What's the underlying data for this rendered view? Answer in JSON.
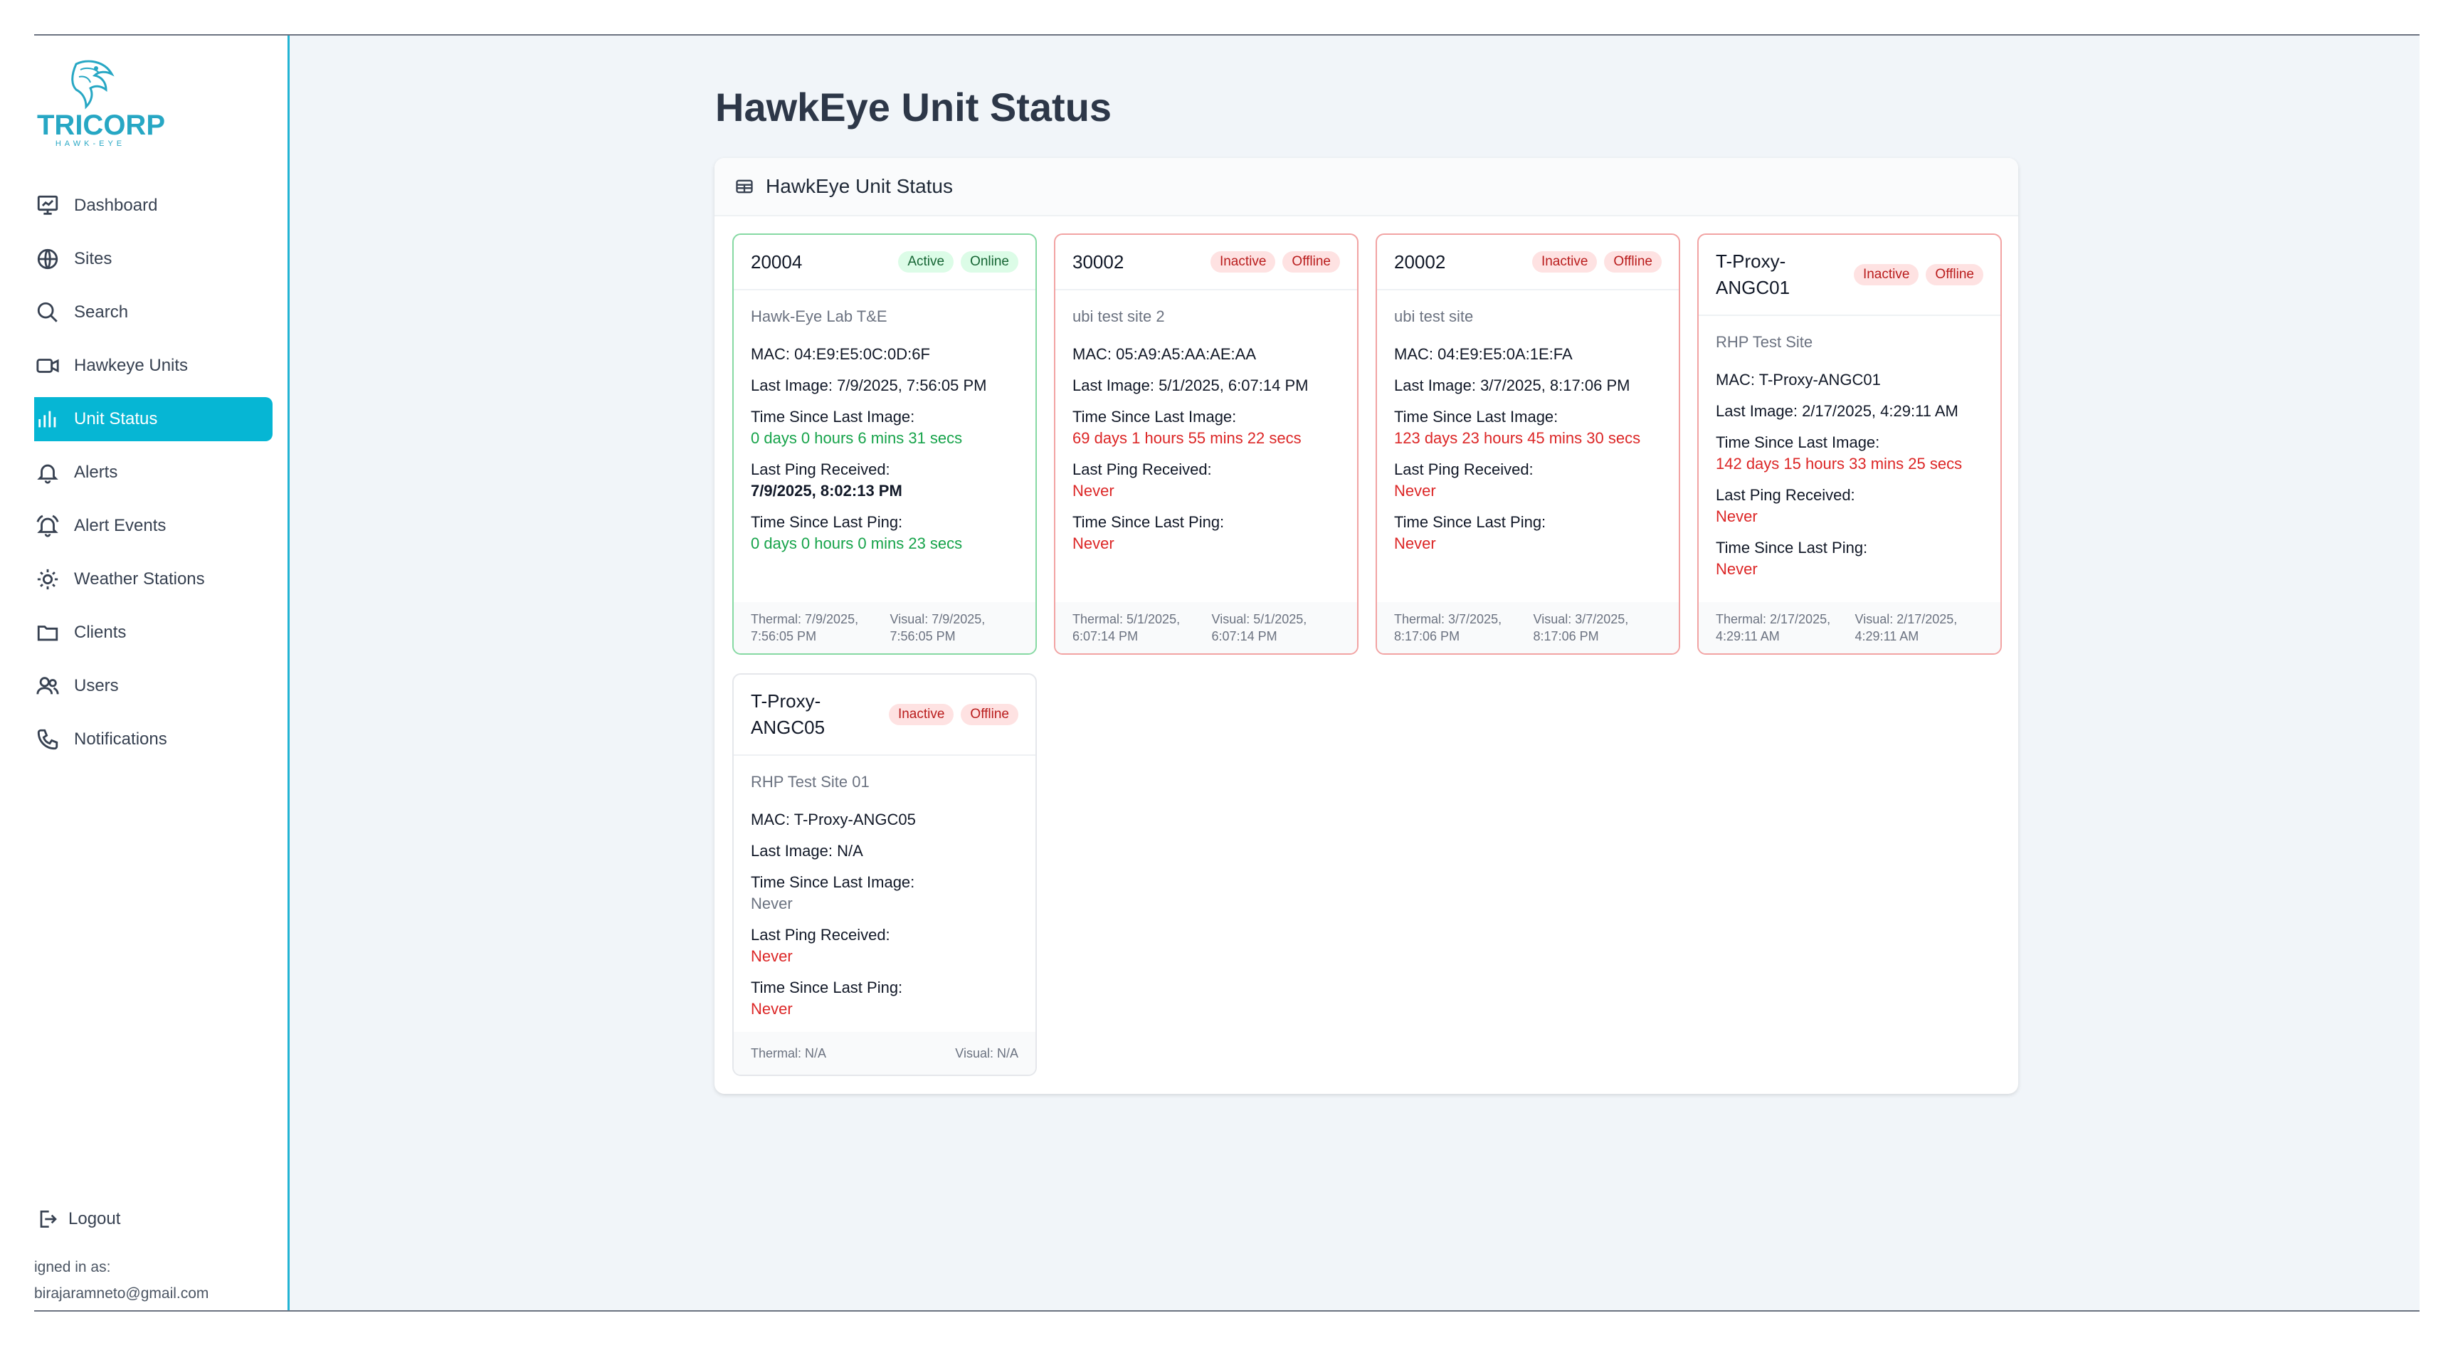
{
  "brand": {
    "name": "TRICORP",
    "tagline": "HAWK-EYE"
  },
  "nav": [
    {
      "label": "Dashboard",
      "icon": "chart-board-icon"
    },
    {
      "label": "Sites",
      "icon": "globe-icon"
    },
    {
      "label": "Search",
      "icon": "search-icon"
    },
    {
      "label": "Hawkeye Units",
      "icon": "video-icon"
    },
    {
      "label": "Unit Status",
      "icon": "bar-chart-icon",
      "active": true
    },
    {
      "label": "Alerts",
      "icon": "bell-icon"
    },
    {
      "label": "Alert Events",
      "icon": "bell-ring-icon"
    },
    {
      "label": "Weather Stations",
      "icon": "sun-icon"
    },
    {
      "label": "Clients",
      "icon": "folder-icon"
    },
    {
      "label": "Users",
      "icon": "users-icon"
    },
    {
      "label": "Notifications",
      "icon": "phone-icon"
    }
  ],
  "logout": {
    "label": "Logout"
  },
  "signed_in": {
    "label": "igned in as:",
    "email": "birajaramneto@gmail.com"
  },
  "page": {
    "title": "HawkEye Unit Status",
    "panel_title": "HawkEye Unit Status"
  },
  "labels": {
    "time_since_last_image": "Time Since Last Image:",
    "last_ping_received": "Last Ping Received:",
    "time_since_last_ping": "Time Since Last Ping:"
  },
  "colors": {
    "accent": "#06b6d4",
    "ok": "#16a34a",
    "bad": "#dc2626"
  },
  "units": [
    {
      "name": "20004",
      "status": "Active",
      "connection": "Online",
      "site": "Hawk-Eye Lab T&E",
      "mac": "MAC: 04:E9:E5:0C:0D:6F",
      "last_image": "Last Image: 7/9/2025, 7:56:05 PM",
      "time_since_image": "0 days 0 hours 6 mins 31 secs",
      "last_ping": "7/9/2025, 8:02:13 PM",
      "time_since_ping": "0 days 0 hours 0 mins 23 secs",
      "thermal": "Thermal: 7/9/2025, 7:56:05 PM",
      "visual": "Visual: 7/9/2025, 7:56:05 PM"
    },
    {
      "name": "30002",
      "status": "Inactive",
      "connection": "Offline",
      "site": "ubi test site 2",
      "mac": "MAC: 05:A9:A5:AA:AE:AA",
      "last_image": "Last Image: 5/1/2025, 6:07:14 PM",
      "time_since_image": "69 days 1 hours 55 mins 22 secs",
      "last_ping": "Never",
      "time_since_ping": "Never",
      "thermal": "Thermal: 5/1/2025, 6:07:14 PM",
      "visual": "Visual: 5/1/2025, 6:07:14 PM"
    },
    {
      "name": "20002",
      "status": "Inactive",
      "connection": "Offline",
      "site": "ubi test site",
      "mac": "MAC: 04:E9:E5:0A:1E:FA",
      "last_image": "Last Image: 3/7/2025, 8:17:06 PM",
      "time_since_image": "123 days 23 hours 45 mins 30 secs",
      "last_ping": "Never",
      "time_since_ping": "Never",
      "thermal": "Thermal: 3/7/2025, 8:17:06 PM",
      "visual": "Visual: 3/7/2025, 8:17:06 PM"
    },
    {
      "name": "T-Proxy-ANGC01",
      "status": "Inactive",
      "connection": "Offline",
      "site": "RHP Test Site",
      "mac": "MAC: T-Proxy-ANGC01",
      "last_image": "Last Image: 2/17/2025, 4:29:11 AM",
      "time_since_image": "142 days 15 hours 33 mins 25 secs",
      "last_ping": "Never",
      "time_since_ping": "Never",
      "thermal": "Thermal: 2/17/2025, 4:29:11 AM",
      "visual": "Visual: 2/17/2025, 4:29:11 AM"
    },
    {
      "name": "T-Proxy-ANGC05",
      "status": "Inactive",
      "connection": "Offline",
      "site": "RHP Test Site 01",
      "mac": "MAC: T-Proxy-ANGC05",
      "last_image": "Last Image: N/A",
      "time_since_image": "Never",
      "last_ping": "Never",
      "time_since_ping": "Never",
      "thermal": "Thermal: N/A",
      "visual": "Visual: N/A"
    }
  ]
}
